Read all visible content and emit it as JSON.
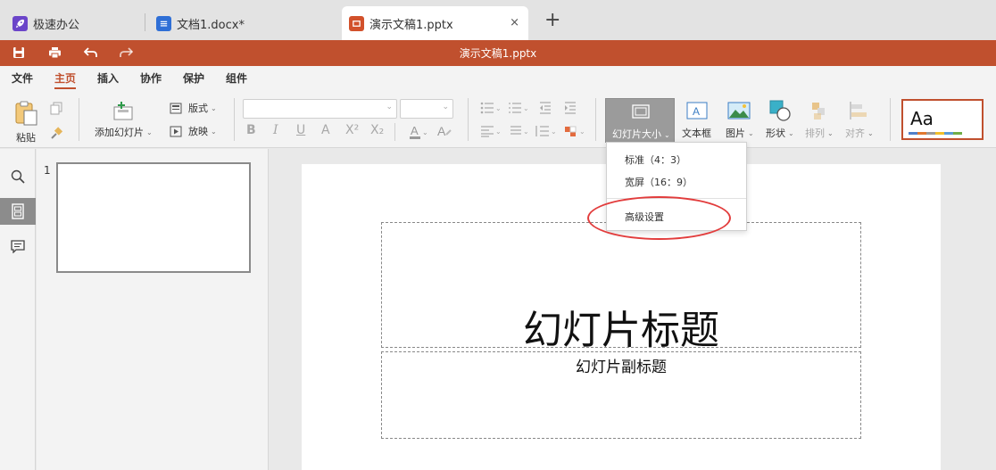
{
  "tabs": [
    {
      "label": "极速办公",
      "icon": "rocket-icon",
      "color": "#6b45c9"
    },
    {
      "label": "文档1.docx*",
      "icon": "document-icon",
      "color": "#2f6fd6"
    },
    {
      "label": "演示文稿1.pptx",
      "icon": "presentation-icon",
      "color": "#d2512b",
      "active": true
    }
  ],
  "new_tab": "+",
  "close_glyph": "×",
  "title_bar": {
    "title": "演示文稿1.pptx",
    "color": "#c0502e"
  },
  "menu": {
    "items": [
      "文件",
      "主页",
      "插入",
      "协作",
      "保护",
      "组件"
    ],
    "active": "主页"
  },
  "ribbon": {
    "paste": "粘贴",
    "add_slide": "添加幻灯片",
    "layout": "版式",
    "play": "放映",
    "format_buttons": [
      "B",
      "I",
      "U",
      "A",
      "X²",
      "X₂"
    ],
    "slide_size": "幻灯片大小",
    "text_box": "文本框",
    "picture": "图片",
    "shape": "形状",
    "arrange": "排列",
    "align": "对齐",
    "theme_preview": "Aa"
  },
  "slide_size_menu": {
    "items": [
      "标准（4：3）",
      "宽屏（16：9）",
      "高级设置"
    ],
    "highlighted": "高级设置"
  },
  "thumbnails": [
    {
      "number": "1"
    }
  ],
  "slide": {
    "title": "幻灯片标题",
    "subtitle": "幻灯片副标题"
  }
}
